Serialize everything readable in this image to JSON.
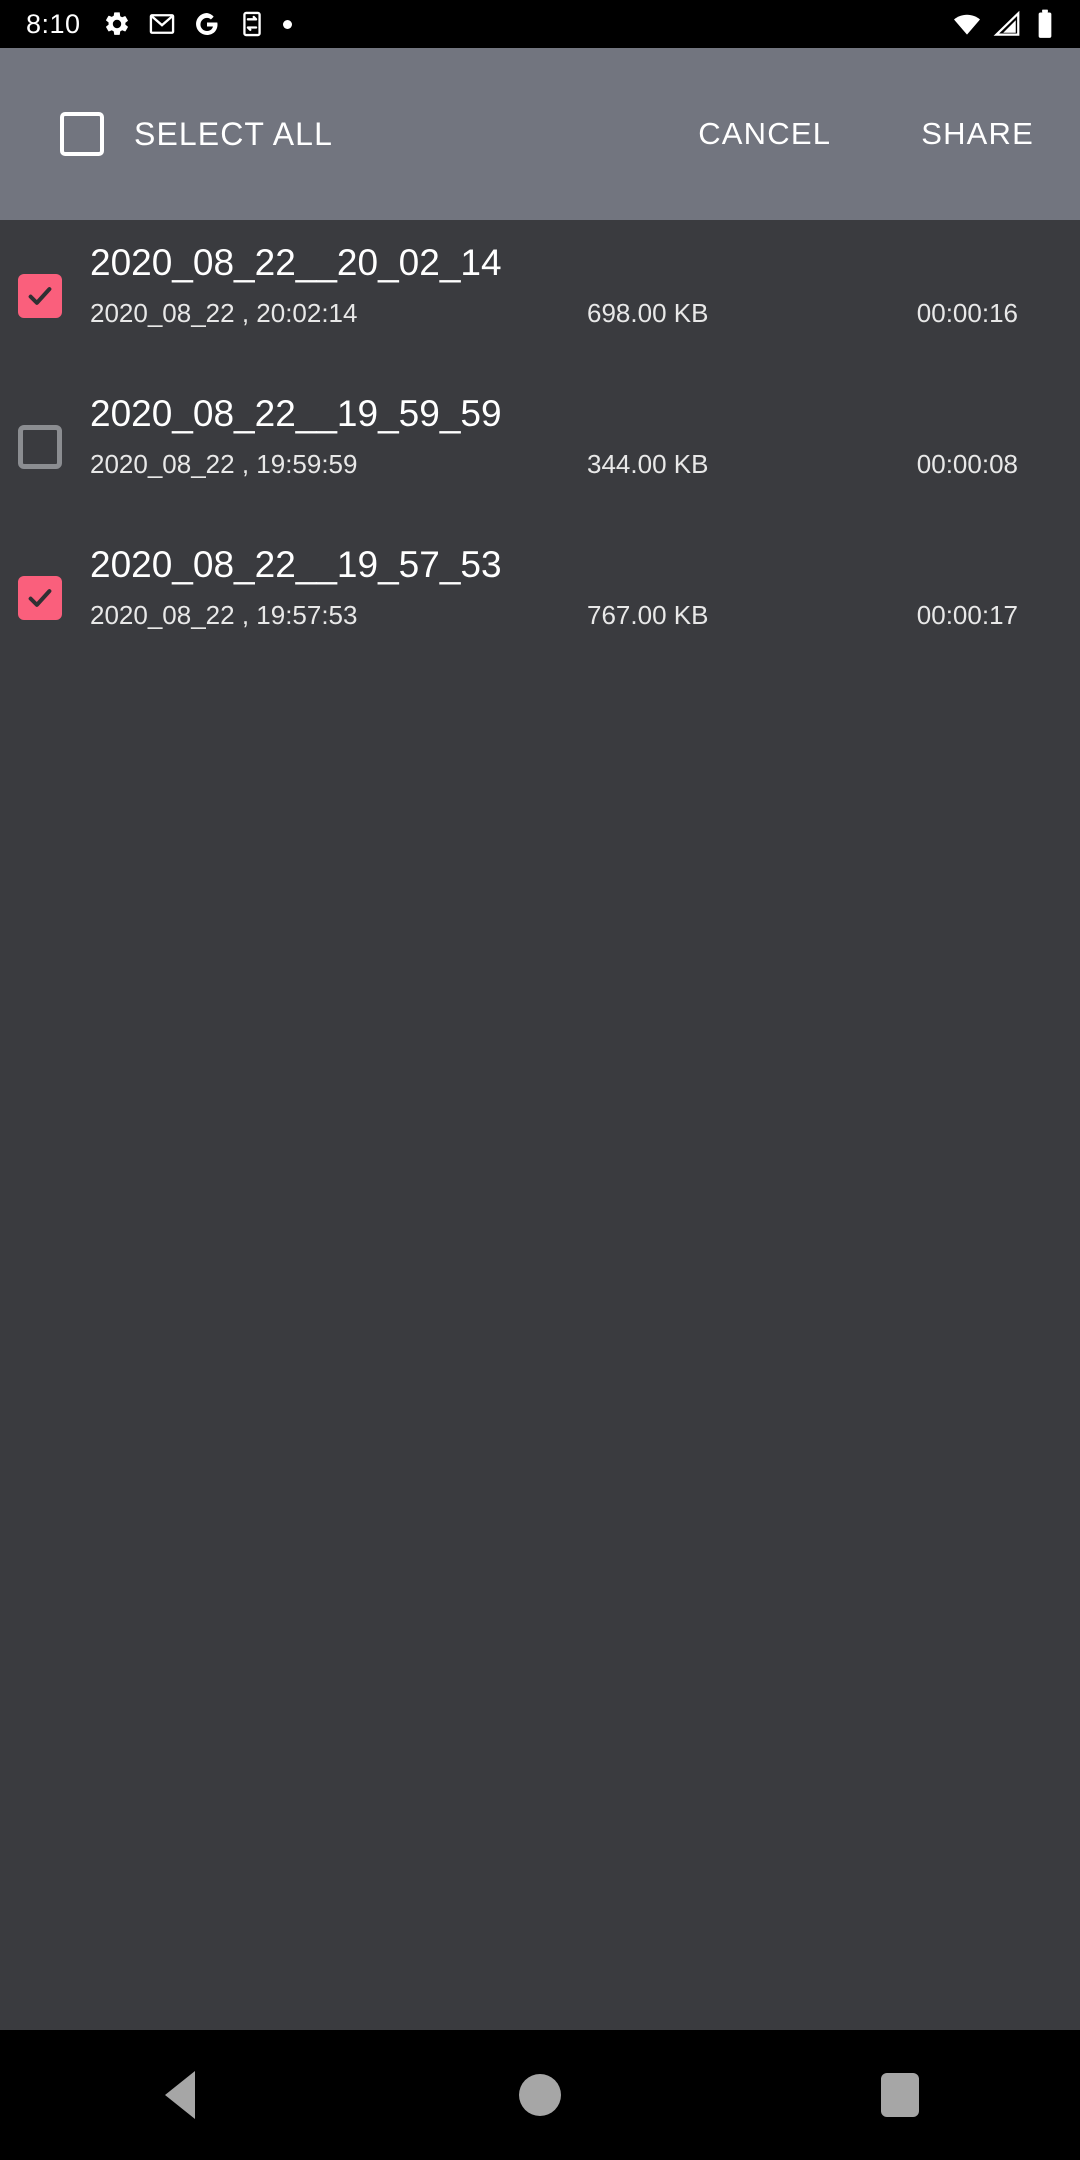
{
  "status_bar": {
    "time": "8:10",
    "left_icons": [
      "gear-icon",
      "gmail-icon",
      "google-g-icon",
      "sync-transfer-icon",
      "dot-icon"
    ],
    "right_icons": [
      "wifi-icon",
      "cellular-signal-icon",
      "battery-icon"
    ]
  },
  "action_bar": {
    "select_all_label": "SELECT ALL",
    "select_all_checked": false,
    "cancel_label": "CANCEL",
    "share_label": "SHARE",
    "background_color": "#72757f"
  },
  "colors": {
    "accent": "#fa5f7c",
    "content_background": "#3a3b3f",
    "status_background": "#000000",
    "nav_icon": "#a6a6a6"
  },
  "list": {
    "columns": [
      "name",
      "date_time",
      "size",
      "duration"
    ],
    "rows": [
      {
        "checked": true,
        "title": "2020_08_22__20_02_14",
        "subtitle": "2020_08_22 , 20:02:14",
        "size": "698.00 KB",
        "duration": "00:00:16"
      },
      {
        "checked": false,
        "title": "2020_08_22__19_59_59",
        "subtitle": "2020_08_22 , 19:59:59",
        "size": "344.00 KB",
        "duration": "00:00:08"
      },
      {
        "checked": true,
        "title": "2020_08_22__19_57_53",
        "subtitle": "2020_08_22 , 19:57:53",
        "size": "767.00 KB",
        "duration": "00:00:17"
      }
    ]
  },
  "nav_bar": {
    "buttons": [
      "back-button",
      "home-button",
      "recents-button"
    ]
  }
}
